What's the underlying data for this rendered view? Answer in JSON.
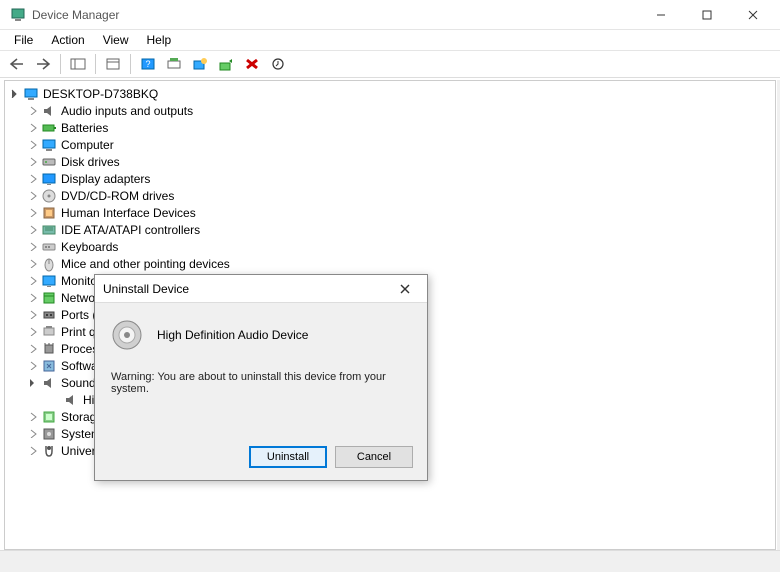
{
  "window": {
    "title": "Device Manager"
  },
  "menu": {
    "file": "File",
    "action": "Action",
    "view": "View",
    "help": "Help"
  },
  "tree": {
    "root": "DESKTOP-D738BKQ",
    "categories": [
      {
        "label": "Audio inputs and outputs",
        "expanded": false
      },
      {
        "label": "Batteries",
        "expanded": false
      },
      {
        "label": "Computer",
        "expanded": false
      },
      {
        "label": "Disk drives",
        "expanded": false
      },
      {
        "label": "Display adapters",
        "expanded": false
      },
      {
        "label": "DVD/CD-ROM drives",
        "expanded": false
      },
      {
        "label": "Human Interface Devices",
        "expanded": false
      },
      {
        "label": "IDE ATA/ATAPI controllers",
        "expanded": false
      },
      {
        "label": "Keyboards",
        "expanded": false
      },
      {
        "label": "Mice and other pointing devices",
        "expanded": false
      },
      {
        "label": "Monitors",
        "expanded": false
      },
      {
        "label": "Network adapters",
        "expanded": false
      },
      {
        "label": "Ports (COM & LPT)",
        "expanded": false
      },
      {
        "label": "Print queues",
        "expanded": false
      },
      {
        "label": "Processors",
        "expanded": false
      },
      {
        "label": "Software devices",
        "expanded": false
      },
      {
        "label": "Sound, video and game controllers",
        "expanded": true
      },
      {
        "label": "Storage controllers",
        "expanded": false
      },
      {
        "label": "System devices",
        "expanded": false
      },
      {
        "label": "Universal Serial Bus controllers",
        "expanded": false
      }
    ],
    "sound_child": "High Definition Audio Device"
  },
  "dialog": {
    "title": "Uninstall Device",
    "device_name": "High Definition Audio Device",
    "warning": "Warning: You are about to uninstall this device from your system.",
    "uninstall": "Uninstall",
    "cancel": "Cancel"
  }
}
